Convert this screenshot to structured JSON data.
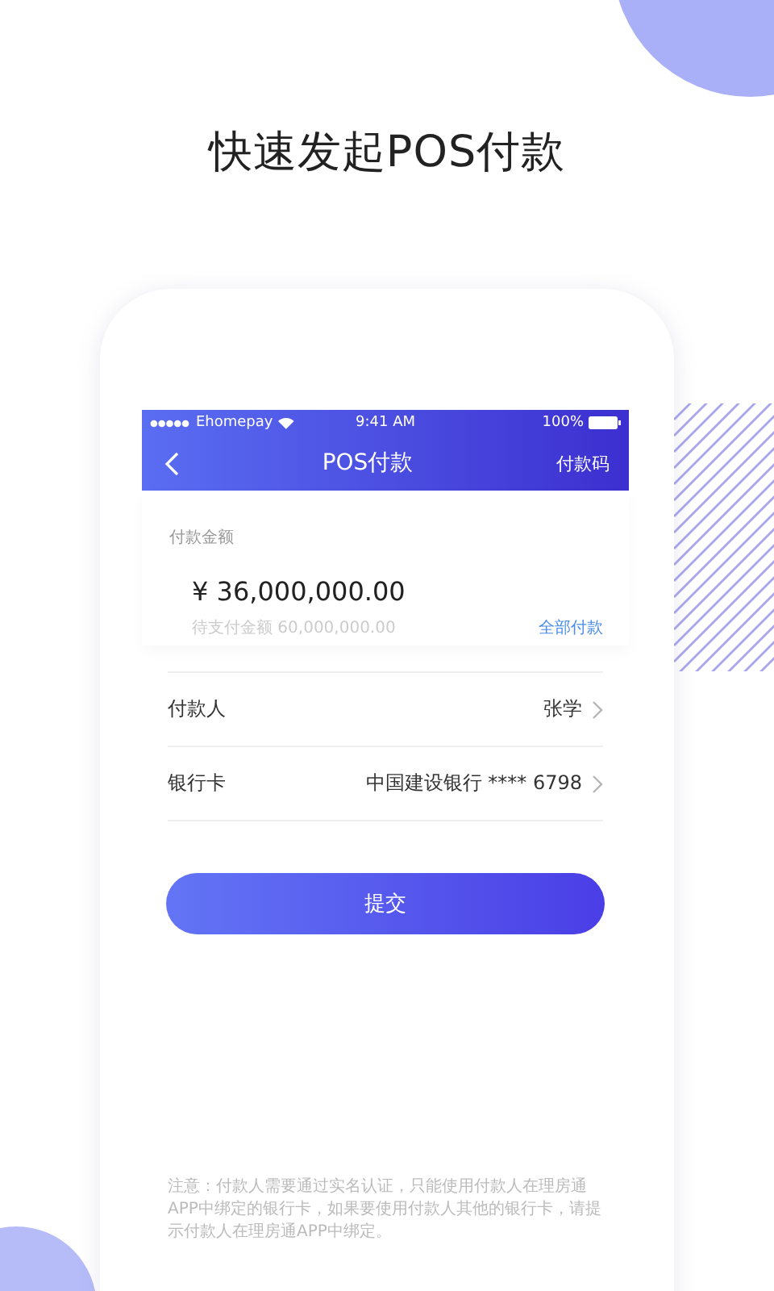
{
  "headline": "快速发起POS付款",
  "status_bar": {
    "carrier": "Ehomepay",
    "time": "9:41 AM",
    "battery": "100%"
  },
  "nav": {
    "title": "POS付款",
    "action": "付款码"
  },
  "amount": {
    "label": "付款金额",
    "value": "¥ 36,000,000.00",
    "pending": "待支付金额 60,000,000.00",
    "pay_all": "全部付款"
  },
  "rows": [
    {
      "label": "付款人",
      "value": "张学"
    },
    {
      "label": "银行卡",
      "value": "中国建设银行 **** 6798"
    }
  ],
  "submit": "提交",
  "notice": "注意：付款人需要通过实名认证，只能使用付款人在理房通APP中绑定的银行卡，如果要使用付款人其他的银行卡，请提示付款人在理房通APP中绑定。"
}
